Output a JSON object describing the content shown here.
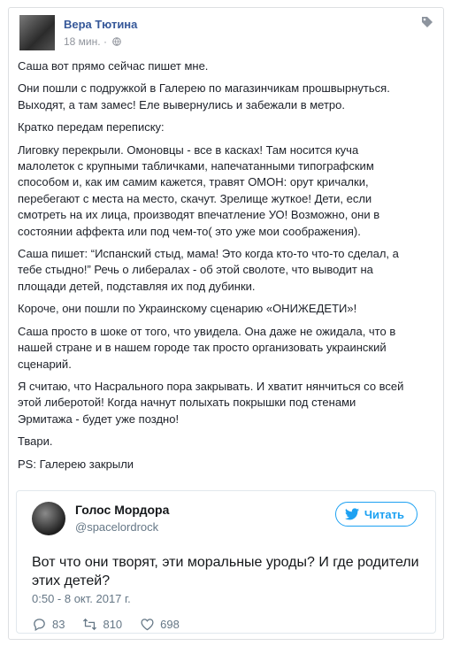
{
  "post": {
    "author": "Вера Тютина",
    "time": "18 мин.",
    "dot": "·",
    "paragraphs": [
      "Саша вот прямо сейчас пишет мне.",
      "Они пошли с подружкой в Галерею по магазинчикам прошвырнуться.\nВыходят, а там замес! Еле вывернулись и забежали в метро.",
      "Кратко передам переписку:",
      "Лиговку перекрыли. Омоновцы - все в касках! Там носится куча\nмалолеток с крупными табличками, напечатанными типографским\nспособом и, как им самим кажется, травят ОМОН: орут кричалки,\nперебегают с места на место, скачут. Зрелище жуткое! Дети, если\nсмотреть на их лица, производят впечатление УО! Возможно, они в\nсостоянии аффекта или под чем-то( это уже мои соображения).",
      "Саша пишет: “Испанский стыд, мама! Это когда кто-то что-то сделал, а\nтебе стыдно!” Речь о либералах - об этой сволоте, что выводит на\nплощади детей, подставляя их под дубинки.",
      "Короче, они пошли по Украинскому сценарию «ОНИЖЕДЕТИ»!",
      "Саша просто в шоке от того, что увидела. Она даже не ожидала, что в\nнашей стране и в нашем городе так просто организовать украинский\nсценарий.",
      "Я считаю, что Насрального пора закрывать. И хватит нянчиться со всей\nэтой либеротой! Когда начнут полыхать покрышки под стенами\nЭрмитажа - будет уже поздно!",
      "Твари.",
      "PS: Галерею закрыли"
    ]
  },
  "tweet": {
    "name": "Голос Мордора",
    "handle": "@spacelordrock",
    "follow_label": "Читать",
    "text": "Вот что они творят, эти моральные уроды? И где родители\nэтих детей?",
    "date": "0:50 - 8 окт. 2017 г.",
    "replies": "83",
    "retweets": "810",
    "likes": "698"
  },
  "colors": {
    "fb_link": "#365899",
    "twitter_blue": "#1da1f2"
  },
  "icons": [
    "globe-icon",
    "tag-icon",
    "twitter-bird-icon",
    "reply-icon",
    "retweet-icon",
    "like-icon"
  ]
}
